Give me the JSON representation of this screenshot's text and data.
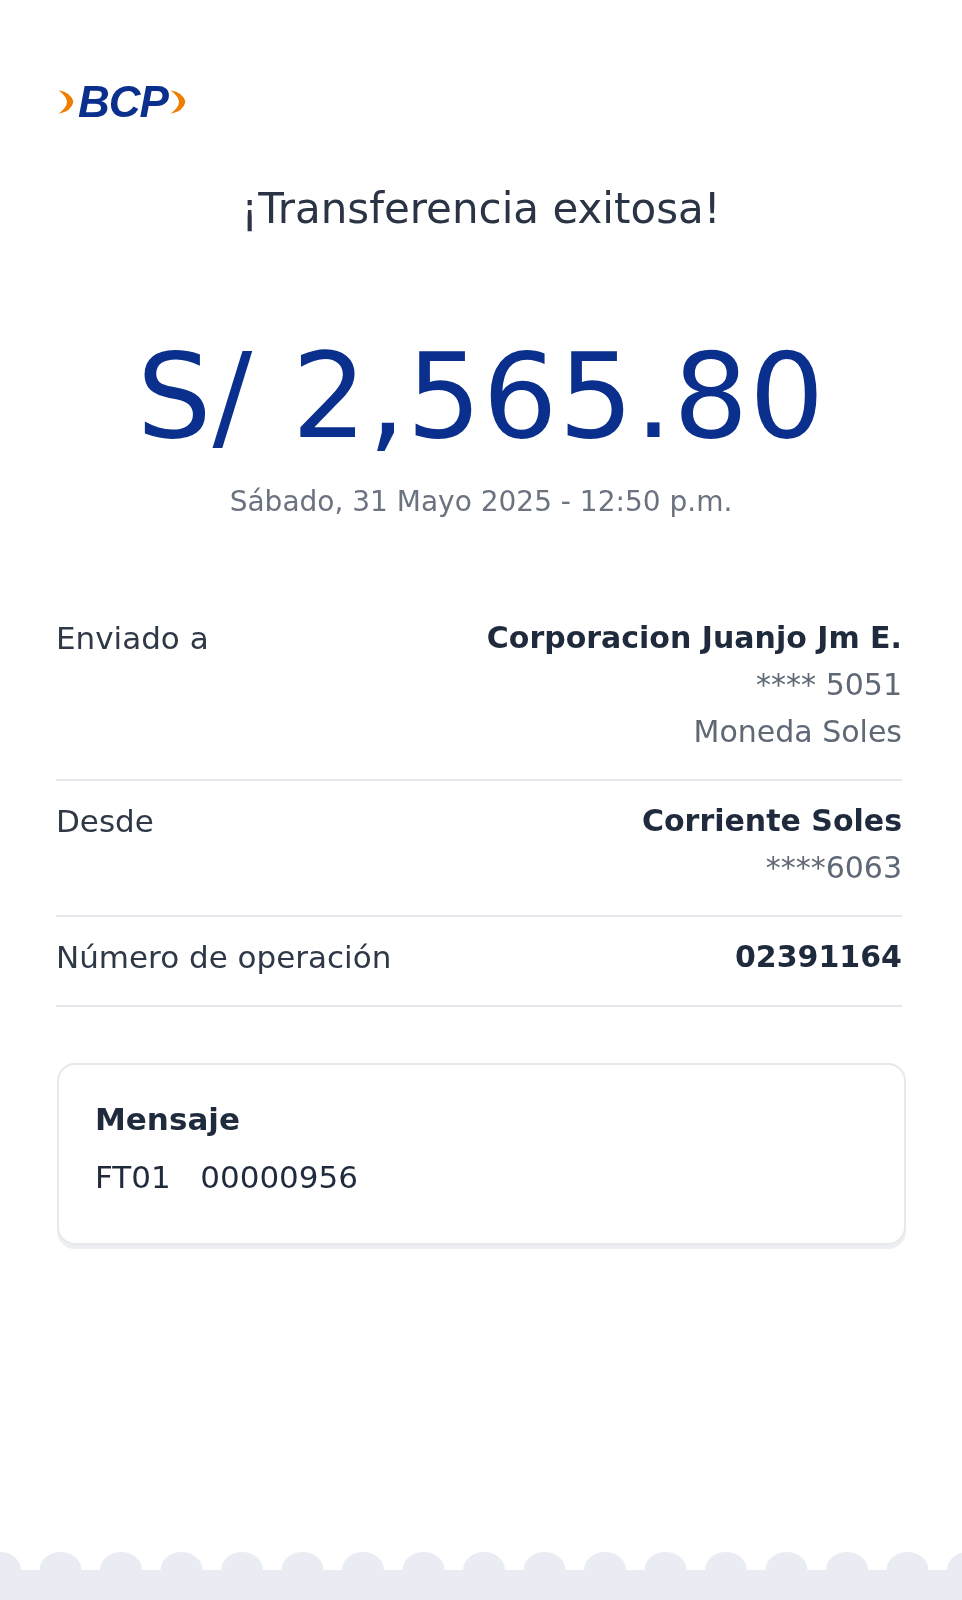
{
  "logo": {
    "text": "BCP"
  },
  "title": "¡Transferencia exitosa!",
  "amount": "S/ 2,565.80",
  "datetime": "Sábado, 31 Mayo 2025 - 12:50 p.m.",
  "details": [
    {
      "label": "Enviado a",
      "values": [
        "Corporacion Juanjo Jm E.",
        "**** 5051",
        "Moneda Soles"
      ]
    },
    {
      "label": "Desde",
      "values": [
        "Corriente Soles",
        "****6063"
      ]
    },
    {
      "label": "Número de operación",
      "values": [
        "02391164"
      ]
    }
  ],
  "message": {
    "title": "Mensaje",
    "text": "FT01   00000956"
  }
}
